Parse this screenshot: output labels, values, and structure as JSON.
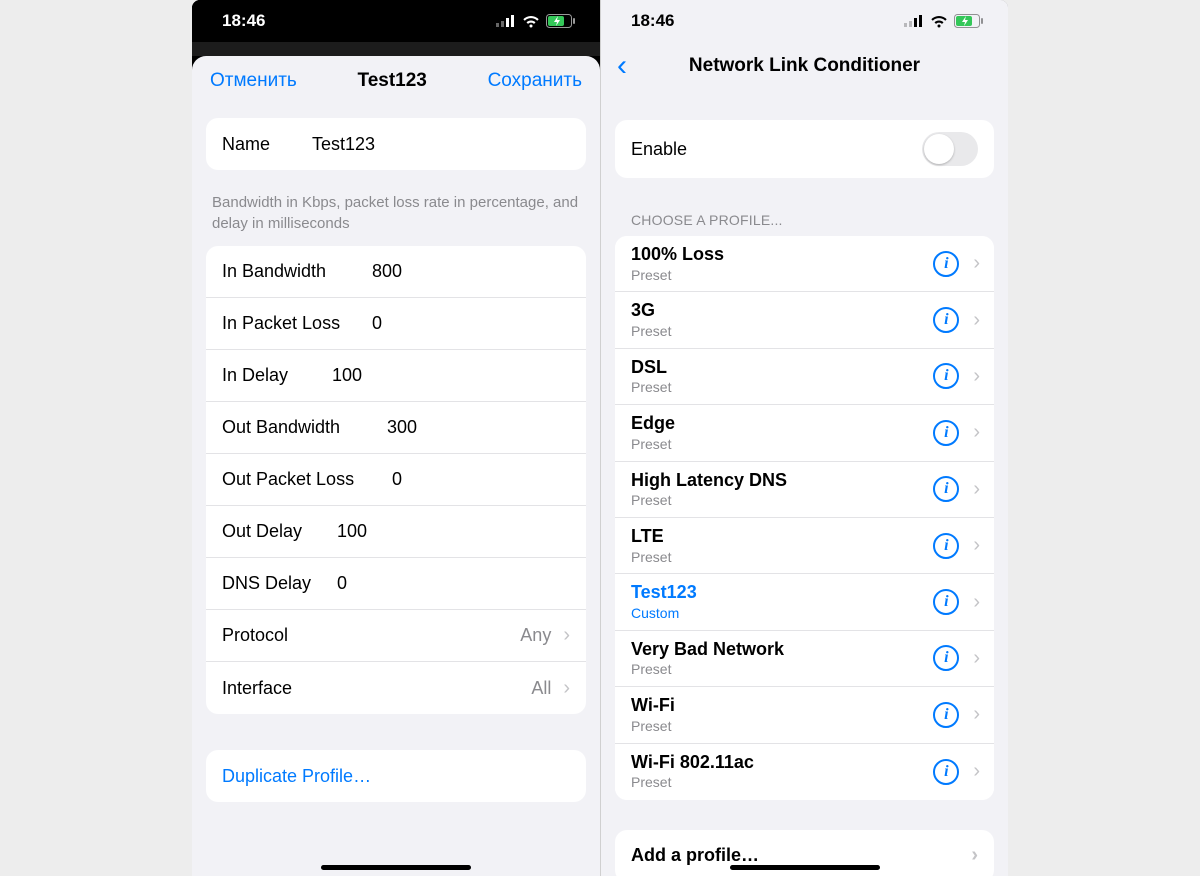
{
  "statusbar": {
    "time": "18:46"
  },
  "left": {
    "nav": {
      "cancel": "Отменить",
      "title": "Test123",
      "save": "Сохранить"
    },
    "name_label": "Name",
    "name_value": "Test123",
    "hint": "Bandwidth in Kbps, packet loss rate in percentage, and delay in milliseconds",
    "rows": {
      "in_bw": {
        "label": "In Bandwidth",
        "value": "800"
      },
      "in_pl": {
        "label": "In Packet Loss",
        "value": "0"
      },
      "in_delay": {
        "label": "In Delay",
        "value": "100"
      },
      "out_bw": {
        "label": "Out Bandwidth",
        "value": "300"
      },
      "out_pl": {
        "label": "Out Packet Loss",
        "value": "0"
      },
      "out_delay": {
        "label": "Out Delay",
        "value": "100"
      },
      "dns_delay": {
        "label": "DNS Delay",
        "value": "0"
      },
      "protocol": {
        "label": "Protocol",
        "value": "Any"
      },
      "interface": {
        "label": "Interface",
        "value": "All"
      }
    },
    "duplicate": "Duplicate Profile…"
  },
  "right": {
    "title": "Network Link Conditioner",
    "enable_label": "Enable",
    "section_header": "CHOOSE A PROFILE...",
    "preset_label": "Preset",
    "custom_label": "Custom",
    "profiles": [
      {
        "name": "100% Loss",
        "sub": "Preset",
        "selected": false
      },
      {
        "name": "3G",
        "sub": "Preset",
        "selected": false
      },
      {
        "name": "DSL",
        "sub": "Preset",
        "selected": false
      },
      {
        "name": "Edge",
        "sub": "Preset",
        "selected": false
      },
      {
        "name": "High Latency DNS",
        "sub": "Preset",
        "selected": false
      },
      {
        "name": "LTE",
        "sub": "Preset",
        "selected": false
      },
      {
        "name": "Test123",
        "sub": "Custom",
        "selected": true
      },
      {
        "name": "Very Bad Network",
        "sub": "Preset",
        "selected": false
      },
      {
        "name": "Wi-Fi",
        "sub": "Preset",
        "selected": false
      },
      {
        "name": "Wi-Fi 802.11ac",
        "sub": "Preset",
        "selected": false
      }
    ],
    "add_profile": "Add a profile…"
  }
}
